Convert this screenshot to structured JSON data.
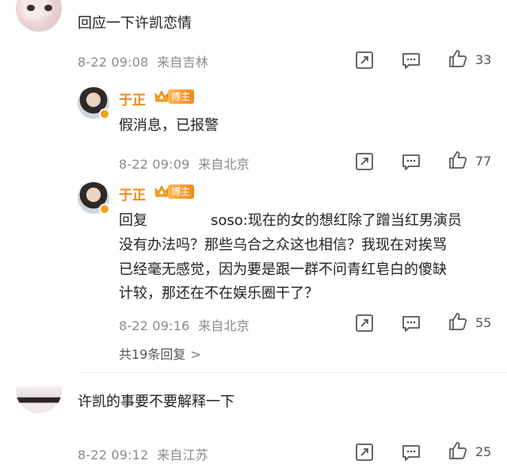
{
  "comment1": {
    "text": "回应一下许凯恋情",
    "date": "8-22 09:08",
    "location": "来自吉林",
    "likes": "33"
  },
  "reply1": {
    "author": "于正",
    "badge": "博主",
    "text": "假消息，已报警",
    "date": "8-22 09:09",
    "location": "来自北京",
    "likes": "77"
  },
  "reply2": {
    "author": "于正",
    "badge": "博主",
    "prefix": "回复",
    "mention_visible": "soso:",
    "line1": "现在的女的想红除了蹭当红男演员",
    "line2": "没有办法吗？那些乌合之众这也相信？我现在对挨骂",
    "line3": "已经毫无感觉，因为要是跟一群不问青红皂白的傻缺",
    "line4": "计较，那还在不在娱乐圈干了？",
    "date": "8-22 09:16",
    "location": "来自北京",
    "likes": "55"
  },
  "replies_summary": {
    "label": "共19条回复",
    "chevron": ">"
  },
  "comment2": {
    "text": "许凯的事要不要解释一下",
    "date": "8-22 09:12",
    "location": "来自江苏",
    "likes": "25"
  },
  "icons": {
    "share": "share-icon",
    "comment": "comment-icon",
    "like": "thumbs-up-icon"
  },
  "colors": {
    "author_name": "#f08a1b",
    "badge_bg": "#f5a623",
    "meta_text": "#8a8a8a"
  }
}
